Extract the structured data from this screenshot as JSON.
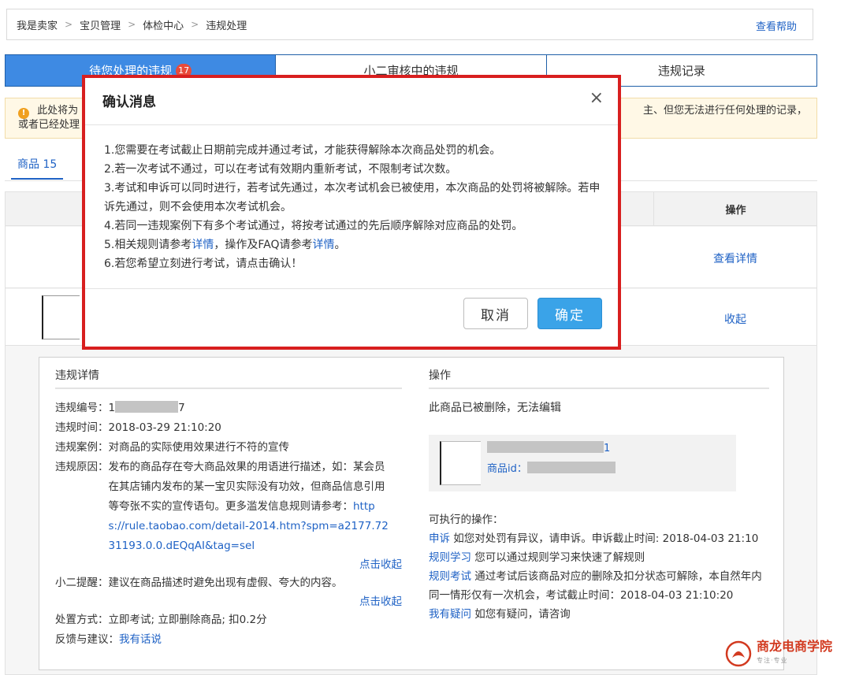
{
  "breadcrumb": [
    "我是卖家",
    "宝贝管理",
    "体检中心",
    "违规处理"
  ],
  "help_link": "查看帮助",
  "tabs": [
    {
      "label": "待您处理的违规",
      "badge": "17"
    },
    {
      "label": "小二审核中的违规"
    },
    {
      "label": "违规记录"
    }
  ],
  "notice": {
    "left_line1": "此处将为",
    "left_line2": "或者已经处理",
    "right_line1": "主、但您无法进行任何处理的记录，"
  },
  "subtab": "商品 15",
  "table": {
    "ops_header": "操作",
    "row1_link": "查看详情",
    "row2_link": "收起"
  },
  "detail": {
    "left_title": "违规详情",
    "fields": {
      "id_label": "违规编号：",
      "id_value_prefix": "1",
      "id_value_suffix": "7",
      "time_label": "违规时间：",
      "time_value": "2018-03-29 21:10:20",
      "case_label": "违规案例：",
      "case_value": "对商品的实际使用效果进行不符的宣传",
      "reason_label": "违规原因：",
      "reason_value": "发布的商品存在夸大商品效果的用语进行描述，如：某会员在其店铺内发布的某一宝贝实际没有功效，但商品信息引用等夸张不实的宣传语句。更多滥发信息规则请参考：",
      "reason_link": "https://rule.taobao.com/detail-2014.htm?spm=a2177.7231193.0.0.dEQqAI&tag=sel",
      "collapse1": "点击收起",
      "tip_label": "小二提醒：",
      "tip_value": "建议在商品描述时避免出现有虚假、夸大的内容。",
      "collapse2": "点击收起",
      "handle_label": "处置方式：",
      "handle_value": "立即考试; 立即删除商品; 扣0.2分",
      "feedback_label": "反馈与建议：",
      "feedback_link": "我有话说"
    },
    "right_title": "操作",
    "deleted_note": "此商品已被删除，无法编辑",
    "product_name_suffix": "1",
    "product_id_label": "商品id：",
    "actions_title": "可执行的操作：",
    "actions": [
      {
        "link": "申诉",
        "text": " 如您对处罚有异议，请申诉。申诉截止时间: 2018-04-03 21:10"
      },
      {
        "link": "规则学习",
        "text": " 您可以通过规则学习来快速了解规则"
      },
      {
        "link": "规则考试",
        "text": " 通过考试后该商品对应的删除及扣分状态可解除，本自然年内同一情形仅有一次机会，考试截止时间：2018-04-03 21:10:20"
      },
      {
        "link": "我有疑问",
        "text": " 如您有疑问，请咨询"
      }
    ]
  },
  "dialog": {
    "title": "确认消息",
    "close": "×",
    "lines": [
      "1.您需要在考试截止日期前完成并通过考试，才能获得解除本次商品处罚的机会。",
      "2.若一次考试不通过，可以在考试有效期内重新考试，不限制考试次数。",
      "3.考试和申诉可以同时进行，若考试先通过，本次考试机会已被使用，本次商品的处罚将被解除。若申诉先通过，则不会使用本次考试机会。",
      "4.若同一违规案例下有多个考试通过，将按考试通过的先后顺序解除对应商品的处罚。"
    ],
    "line5_prefix": "5.相关规则请参考",
    "line5_link1": "详情",
    "line5_mid": "，操作及FAQ请参考",
    "line5_link2": "详情",
    "line5_suffix": "。",
    "line6": "6.若您希望立刻进行考试，请点击确认！",
    "cancel": "取消",
    "ok": "确定"
  },
  "watermark": {
    "name": "商龙电商学院",
    "sub": "专注·专业"
  },
  "colors": {
    "primary_blue": "#3e8ae3",
    "link": "#1f62c5",
    "highlight_red": "#d81f1f",
    "ok_button": "#3aa3e8"
  }
}
